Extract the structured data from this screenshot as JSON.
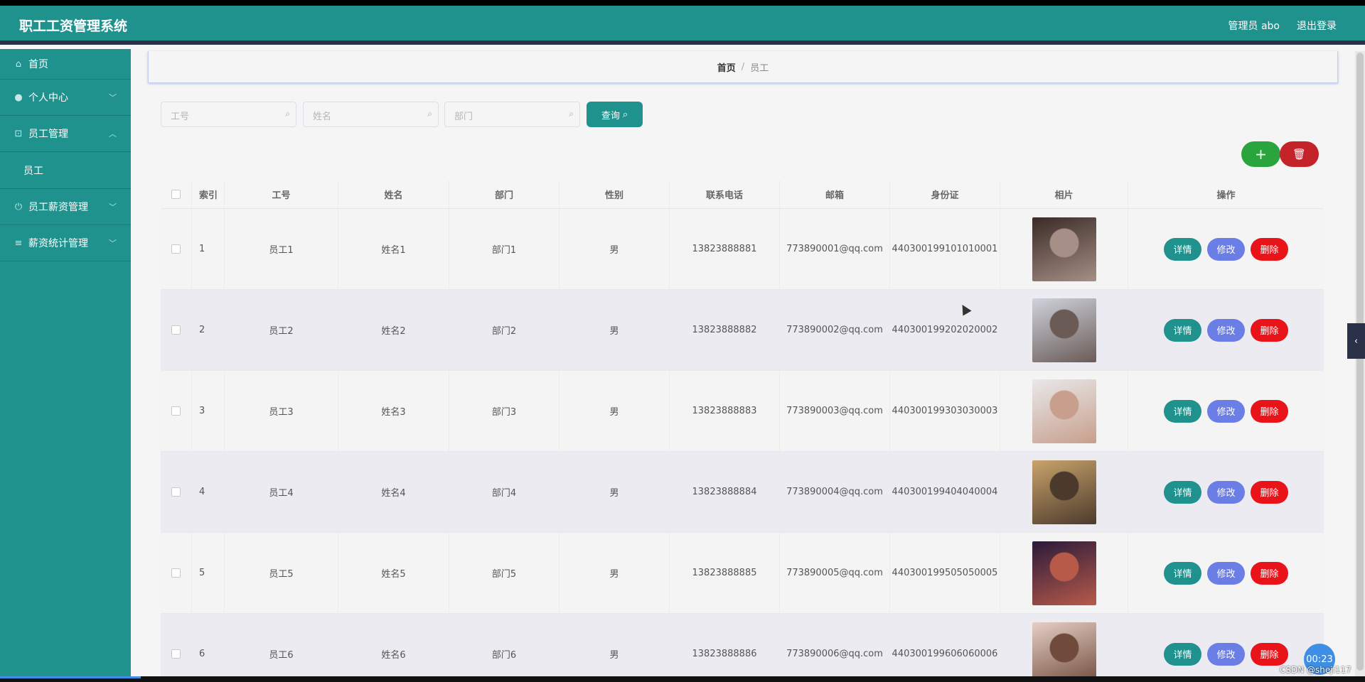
{
  "header": {
    "title": "职工工资管理系统",
    "admin_label": "管理员 abo",
    "logout_label": "退出登录"
  },
  "sidebar": {
    "items": [
      {
        "label": "首页",
        "icon": "home-icon"
      },
      {
        "label": "个人中心",
        "icon": "user-icon"
      },
      {
        "label": "员工管理",
        "icon": "grid-icon"
      },
      {
        "label": "员工",
        "icon": ""
      },
      {
        "label": "员工薪资管理",
        "icon": "power-icon"
      },
      {
        "label": "薪资统计管理",
        "icon": "menu-icon"
      }
    ]
  },
  "breadcrumb": {
    "home": "首页",
    "separator": "/",
    "current": "员工"
  },
  "search": {
    "no_placeholder": "工号",
    "name_placeholder": "姓名",
    "dept_placeholder": "部门",
    "query_label": "查询"
  },
  "actions": {
    "add_label": "+",
    "delete_icon": "trash-icon"
  },
  "table": {
    "headers": [
      "索引",
      "工号",
      "姓名",
      "部门",
      "性别",
      "联系电话",
      "邮箱",
      "身份证",
      "相片",
      "操作"
    ],
    "rows": [
      {
        "idx": "1",
        "no": "员工1",
        "name": "姓名1",
        "dept": "部门1",
        "sex": "男",
        "tel": "13823888881",
        "mail": "773890001@qq.com",
        "id": "440300199101010001"
      },
      {
        "idx": "2",
        "no": "员工2",
        "name": "姓名2",
        "dept": "部门2",
        "sex": "男",
        "tel": "13823888882",
        "mail": "773890002@qq.com",
        "id": "440300199202020002"
      },
      {
        "idx": "3",
        "no": "员工3",
        "name": "姓名3",
        "dept": "部门3",
        "sex": "男",
        "tel": "13823888883",
        "mail": "773890003@qq.com",
        "id": "440300199303030003"
      },
      {
        "idx": "4",
        "no": "员工4",
        "name": "姓名4",
        "dept": "部门4",
        "sex": "男",
        "tel": "13823888884",
        "mail": "773890004@qq.com",
        "id": "440300199404040004"
      },
      {
        "idx": "5",
        "no": "员工5",
        "name": "姓名5",
        "dept": "部门5",
        "sex": "男",
        "tel": "13823888885",
        "mail": "773890005@qq.com",
        "id": "440300199505050005"
      },
      {
        "idx": "6",
        "no": "员工6",
        "name": "姓名6",
        "dept": "部门6",
        "sex": "男",
        "tel": "13823888886",
        "mail": "773890006@qq.com",
        "id": "440300199606060006"
      }
    ],
    "op_labels": {
      "detail": "详情",
      "edit": "修改",
      "remove": "删除"
    }
  },
  "overlay": {
    "timer": "00:23",
    "watermark": "CSDN @sheji117"
  },
  "colors": {
    "accent": "#20928e",
    "edit": "#6b7ee6",
    "remove": "#e8141a",
    "add": "#2aa43d"
  }
}
